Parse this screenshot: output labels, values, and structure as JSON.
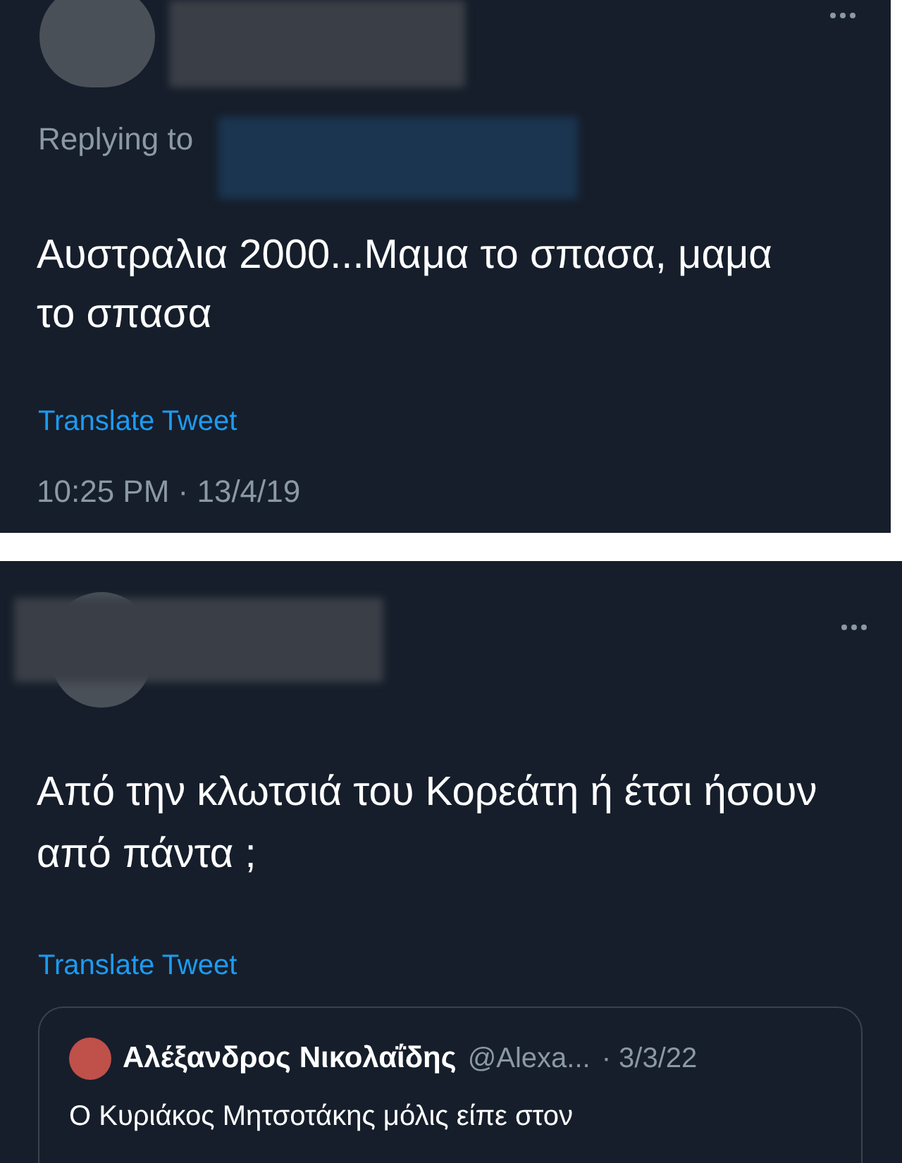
{
  "tweets": [
    {
      "replying_to": "Replying to",
      "text": "Αυστραλια 2000...Μαμα το σπασα, μαμα το σπασα",
      "translate": "Translate Tweet",
      "timestamp": "10:25 PM · 13/4/19"
    },
    {
      "text": "Από την κλωτσιά του Κορεάτη ή έτσι ήσουν από πάντα ;",
      "translate": "Translate Tweet",
      "quote": {
        "name": "Αλέξανδρος Νικολαΐδης",
        "handle": "@Alexa...",
        "date": "· 3/3/22",
        "text": "Ο Κυριάκος Μητσοτάκης μόλις είπε στον"
      }
    }
  ]
}
